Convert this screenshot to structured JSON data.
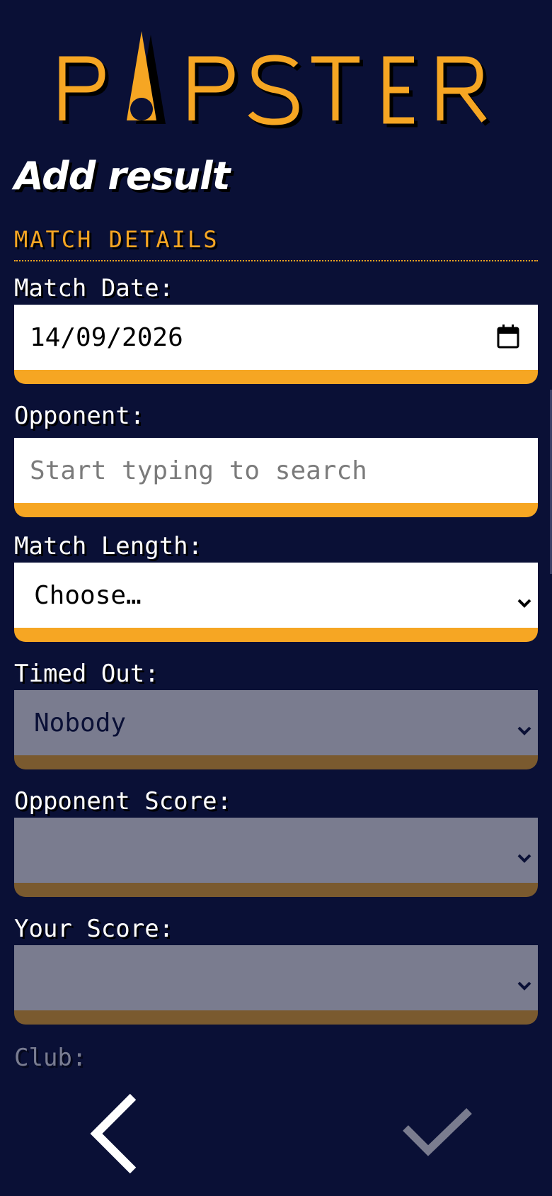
{
  "brand": {
    "logo_text": "PAPSTER",
    "colors": {
      "background": "#0a1036",
      "accent": "#f6a623",
      "disabled_field": "#7a7c8f",
      "disabled_bar": "#7a5a2f"
    }
  },
  "page": {
    "title": "Add result"
  },
  "section": {
    "title": "MATCH DETAILS"
  },
  "form": {
    "match_date": {
      "label": "Match Date:",
      "value": "14/09/2026",
      "icon": "calendar-icon"
    },
    "opponent": {
      "label": "Opponent:",
      "placeholder": "Start typing to search"
    },
    "match_length": {
      "label": "Match Length:",
      "selected": "Choose…",
      "icon": "chevron-down-icon"
    },
    "timed_out": {
      "label": "Timed Out:",
      "selected": "Nobody",
      "icon": "chevron-down-icon"
    },
    "opponent_score": {
      "label": "Opponent Score:",
      "selected": "",
      "icon": "chevron-down-icon"
    },
    "your_score": {
      "label": "Your Score:",
      "selected": "",
      "icon": "chevron-down-icon"
    },
    "club": {
      "label": "Club:"
    }
  },
  "navigation": {
    "back_icon": "back-chevron-icon",
    "confirm_icon": "checkmark-icon"
  }
}
